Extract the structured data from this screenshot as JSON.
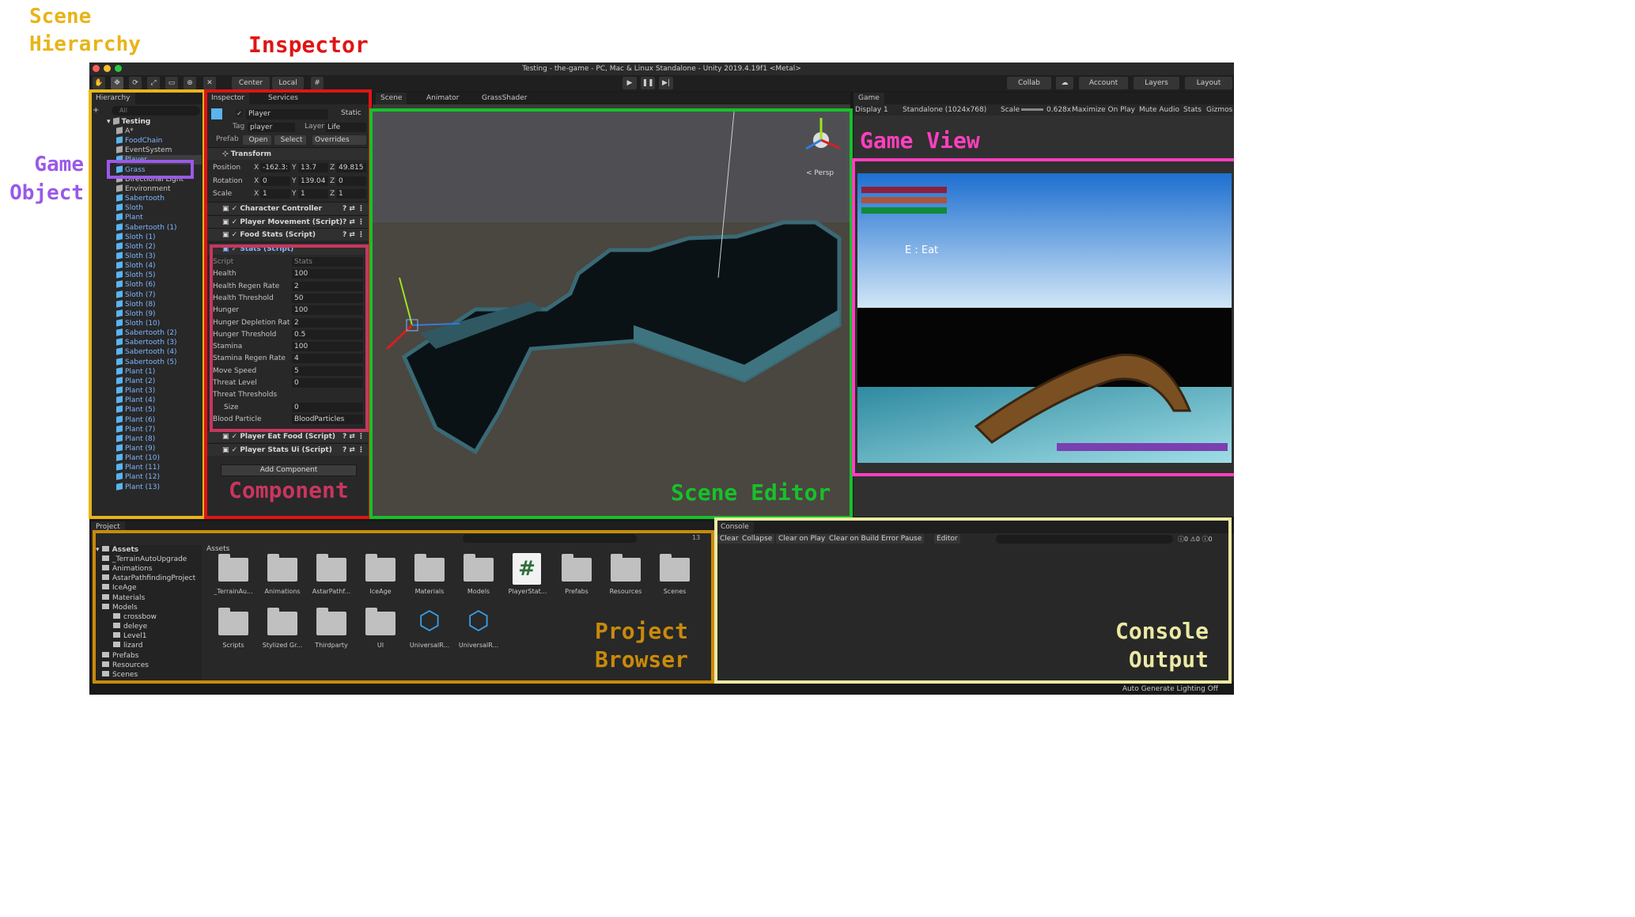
{
  "annotations": {
    "scene_hierarchy": "Scene\nHierarchy",
    "inspector": "Inspector",
    "game_object": "Game\nObject",
    "game_view": "Game View",
    "component": "Component",
    "scene_editor": "Scene Editor",
    "project_browser": "Project\nBrowser",
    "console_output": "Console\nOutput"
  },
  "colors": {
    "hierarchy": "#e8b418",
    "inspector": "#e01414",
    "game_object": "#9b59e8",
    "scene": "#16c12a",
    "game": "#ff3fbf",
    "component": "#c8365e",
    "project": "#c98a0b",
    "console": "#ece9a4"
  },
  "window": {
    "title": "Testing - the-game - PC, Mac & Linux Standalone - Unity 2019.4.19f1 <Metal>"
  },
  "toolbar": {
    "center": "Center",
    "local": "Local",
    "collab": "Collab",
    "account": "Account",
    "layers": "Layers",
    "layout": "Layout"
  },
  "hierarchy": {
    "tab": "Hierarchy",
    "search_placeholder": "All",
    "scene": "Testing",
    "items": [
      "A*",
      "FoodChain",
      "EventSystem",
      "Player",
      "Grass",
      "Directional Light",
      "Environment",
      "Sabertooth",
      "Sloth",
      "Plant",
      "Sabertooth (1)",
      "Sloth (1)",
      "Sloth (2)",
      "Sloth (3)",
      "Sloth (4)",
      "Sloth (5)",
      "Sloth (6)",
      "Sloth (7)",
      "Sloth (8)",
      "Sloth (9)",
      "Sloth (10)",
      "Sabertooth (2)",
      "Sabertooth (3)",
      "Sabertooth (4)",
      "Sabertooth (5)",
      "Plant (1)",
      "Plant (2)",
      "Plant (3)",
      "Plant (4)",
      "Plant (5)",
      "Plant (6)",
      "Plant (7)",
      "Plant (8)",
      "Plant (9)",
      "Plant (10)",
      "Plant (11)",
      "Plant (12)",
      "Plant (13)"
    ]
  },
  "inspector": {
    "tab": "Inspector",
    "services_tab": "Services",
    "object_name": "Player",
    "static": "Static",
    "tag_label": "Tag",
    "tag": "player",
    "layer_label": "Layer",
    "layer": "Life",
    "prefab_label": "Prefab",
    "open": "Open",
    "select": "Select",
    "overrides": "Overrides",
    "transform": {
      "title": "Transform",
      "position_label": "Position",
      "rotation_label": "Rotation",
      "scale_label": "Scale",
      "position": [
        "-162.3:",
        "13.7",
        "49.815"
      ],
      "rotation": [
        "0",
        "139.04",
        "0"
      ],
      "scale": [
        "1",
        "1",
        "1"
      ]
    },
    "components": [
      "Character Controller",
      "Player Movement (Script)",
      "Food Stats (Script)"
    ],
    "stats": {
      "title": "Stats (Script)",
      "fields": [
        [
          "Script",
          "Stats"
        ],
        [
          "Health",
          "100"
        ],
        [
          "Health Regen Rate",
          "2"
        ],
        [
          "Health Threshold",
          "50"
        ],
        [
          "Hunger",
          "100"
        ],
        [
          "Hunger Depletion Rat",
          "2"
        ],
        [
          "Hunger Threshold",
          "0.5"
        ],
        [
          "Stamina",
          "100"
        ],
        [
          "Stamina Regen Rate",
          "4"
        ],
        [
          "Move Speed",
          "5"
        ],
        [
          "Threat Level",
          "0"
        ],
        [
          "Threat Thresholds",
          ""
        ],
        [
          "Size",
          "0"
        ],
        [
          "Blood Particle",
          "BloodParticles"
        ]
      ]
    },
    "components2": [
      "Player Eat Food (Script)",
      "Player Stats Ui (Script)"
    ],
    "add_component": "Add Component"
  },
  "scene": {
    "tabs": [
      "Scene",
      "Animator",
      "GrassShader"
    ],
    "persp": "< Persp"
  },
  "game": {
    "tab": "Game",
    "display": "Display 1",
    "resolution": "Standalone (1024x768)",
    "scale_label": "Scale",
    "scale": "0.628x",
    "max_on_play": "Maximize On Play",
    "mute": "Mute Audio",
    "stats": "Stats",
    "gizmos": "Gizmos",
    "hud_text": "E : Eat"
  },
  "project": {
    "tab": "Project",
    "tree_root": "Assets",
    "tree": [
      "_TerrainAutoUpgrade",
      "Animations",
      "AstarPathfindingProject",
      "IceAge",
      "Materials",
      "Models",
      "crossbow",
      "deleye",
      "Level1",
      "lizard",
      "Prefabs",
      "Resources",
      "Scenes"
    ],
    "breadcrumb": "Assets",
    "row1": [
      "_TerrainAu...",
      "Animations",
      "AstarPathf...",
      "IceAge",
      "Materials",
      "Models",
      "PlayerStat...",
      "Prefabs",
      "Resources",
      "Scenes"
    ],
    "row2": [
      "Scripts",
      "Stylized Gr...",
      "Thirdparty",
      "UI",
      "UniversalR...",
      "UniversalR..."
    ],
    "count": "13"
  },
  "console": {
    "tab": "Console",
    "buttons": [
      "Clear",
      "Collapse",
      "Clear on Play",
      "Clear on Build",
      "Error Pause",
      "Editor"
    ],
    "counts": [
      "0",
      "0",
      "0"
    ]
  },
  "status": {
    "text": "Auto Generate Lighting Off"
  }
}
